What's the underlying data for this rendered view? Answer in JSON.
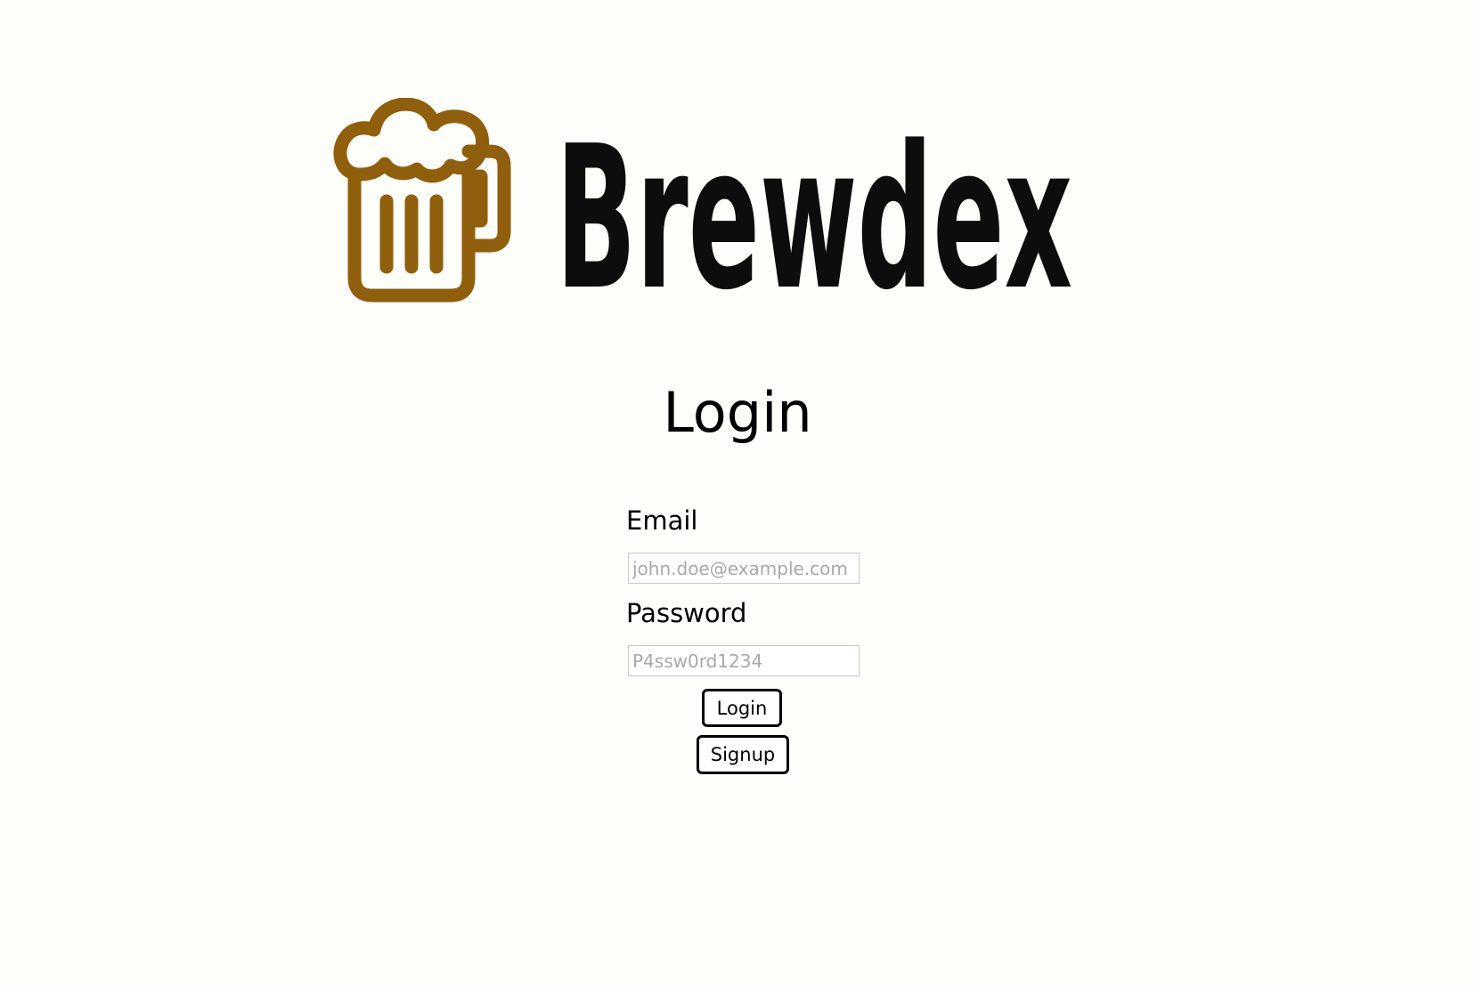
{
  "brand": {
    "name": "Brewdex",
    "icon": "beer-mug-icon",
    "icon_color": "#8f5f0b",
    "text_color": "#0d0d0d"
  },
  "form": {
    "title": "Login",
    "email_label": "Email",
    "email_placeholder": "john.doe@example.com",
    "password_label": "Password",
    "password_placeholder": "P4ssw0rd1234",
    "login_button": "Login",
    "signup_button": "Signup"
  },
  "colors": {
    "background": "#fefefa",
    "input_border": "#c8c8c8",
    "button_border": "#000000"
  }
}
